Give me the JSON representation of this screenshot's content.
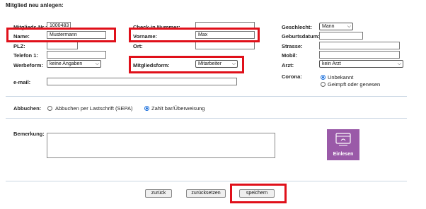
{
  "page_title": "Mitglied neu anlegen:",
  "col1": {
    "mitgliedsnr_label": "Mitglieds-Nr.:",
    "mitgliedsnr_value": "1000483",
    "name_label": "Name:",
    "name_value": "Mustermann",
    "plz_label": "PLZ:",
    "plz_value": "",
    "telefon_label": "Telefon 1:",
    "telefon_value": "",
    "werbeform_label": "Werbeform:",
    "werbeform_value": "keine Angaben",
    "email_label": "e-mail:",
    "email_value": ""
  },
  "col2": {
    "checkin_label": "Check-in Nummer:",
    "checkin_value": "",
    "vorname_label": "Vorname:",
    "vorname_value": "Max",
    "ort_label": "Ort:",
    "ort_value": "",
    "mitgliedsform_label": "Mitgliedsform:",
    "mitgliedsform_value": "Mitarbeiter"
  },
  "col3": {
    "geschlecht_label": "Geschlecht:",
    "geschlecht_value": "Mann",
    "geburtsdatum_label": "Geburtsdatum:",
    "geburtsdatum_value": "",
    "strasse_label": "Strasse:",
    "strasse_value": "",
    "mobil_label": "Mobil:",
    "mobil_value": "",
    "arzt_label": "Arzt:",
    "arzt_value": "kein Arzt",
    "corona_label": "Corona:",
    "corona_options": [
      "Unbekannt",
      "Geimpft oder genesen"
    ]
  },
  "abbuchen": {
    "label": "Abbuchen:",
    "options": [
      "Abbuchen per Lastschrift (SEPA)",
      "Zahlt bar/Überweisung"
    ]
  },
  "bemerkung": {
    "label": "Bemerkung:",
    "value": ""
  },
  "einlesen_label": "Einlesen",
  "buttons": {
    "back": "zurück",
    "reset": "zurücksetzen",
    "save": "speichern"
  },
  "colors": {
    "highlight": "#e0101a",
    "einlesen_bg": "#9a5aa8",
    "divider": "#c9d6e3",
    "radio_selected": "#1a6fdc"
  },
  "icons": [
    "card-reader-icon",
    "chevron-down-icon"
  ]
}
